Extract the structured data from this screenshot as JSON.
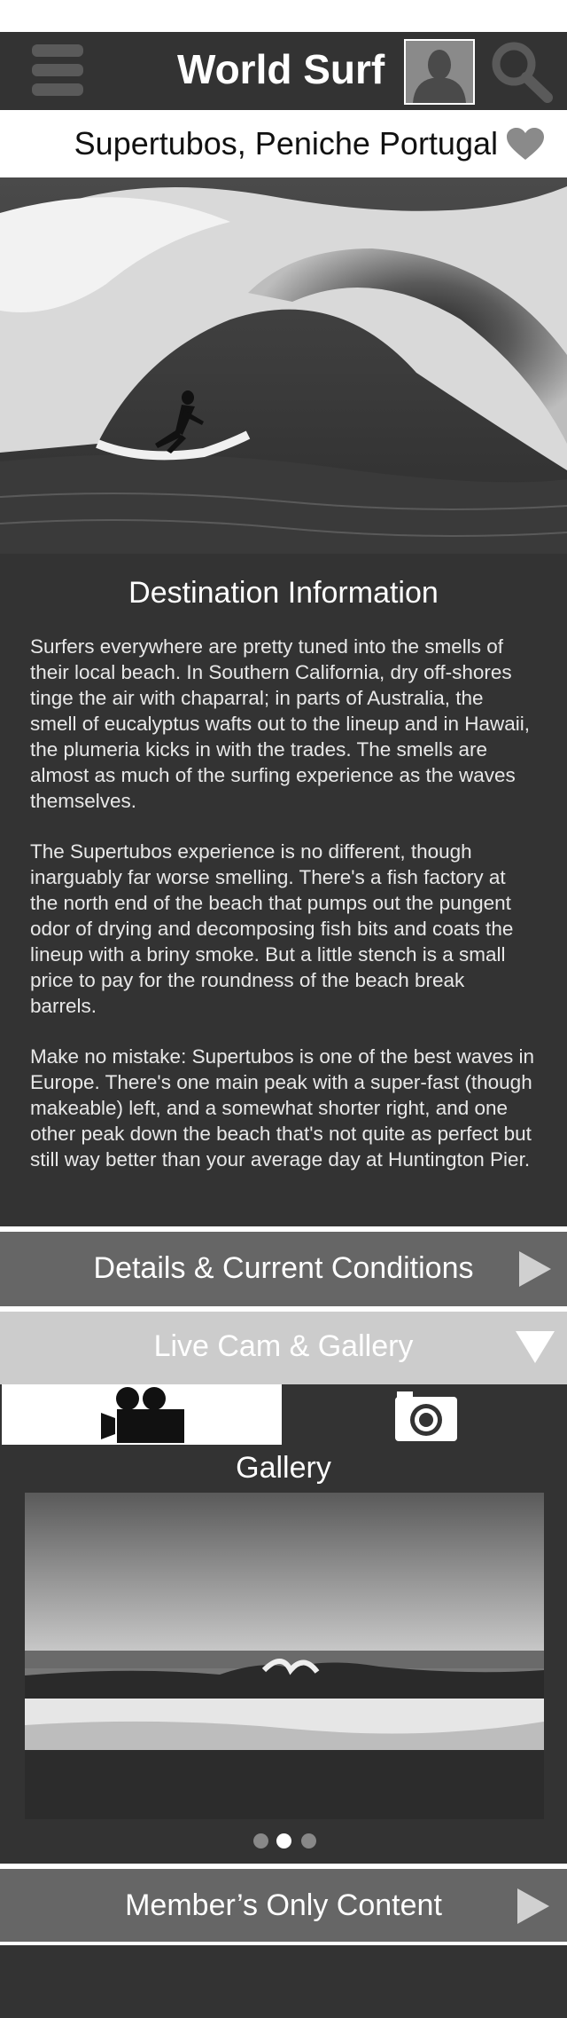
{
  "header": {
    "title": "World Surf",
    "icons": [
      "menu-icon",
      "avatar-icon",
      "search-icon"
    ]
  },
  "location": {
    "title": "Supertubos, Peniche Portugal",
    "favorite_icon": "heart-icon"
  },
  "destination": {
    "heading": "Destination Information",
    "paragraphs": [
      "Surfers everywhere are pretty tuned into the smells of their local beach. In Southern California, dry off-shores tinge the air with chaparral; in parts of Australia, the smell of eucalyptus wafts out to the lineup and in Hawaii, the plumeria kicks in with the trades. The smells are almost as much of the surfing experience as the waves themselves.",
      "The Supertubos experience is no different, though inarguably far worse smelling. There's a fish factory at the north end of the beach that pumps out the pungent odor of drying and decomposing fish bits and coats the lineup with a briny smoke. But a little stench is a small price to pay for the roundness of the beach break barrels.",
      "Make no mistake: Supertubos is one of the best waves in Europe. There's one main peak with a super-fast (though makeable) left, and a somewhat shorter right, and one other peak down the beach that's not quite as perfect but still way better than your average day at Huntington Pier."
    ]
  },
  "sections": {
    "details": "Details & Current Conditions",
    "livecam": "Live Cam & Gallery",
    "members": "Member’s Only Content"
  },
  "media_tabs": [
    {
      "name": "video",
      "icon": "video-camera-icon",
      "selected": true
    },
    {
      "name": "photo",
      "icon": "photo-camera-icon",
      "selected": false
    }
  ],
  "gallery": {
    "label": "Gallery",
    "page_count": 3,
    "active_page": 2
  },
  "colors": {
    "header_bg": "#333333",
    "row_bg": "#666666",
    "row_active_bg": "#cccccc"
  }
}
